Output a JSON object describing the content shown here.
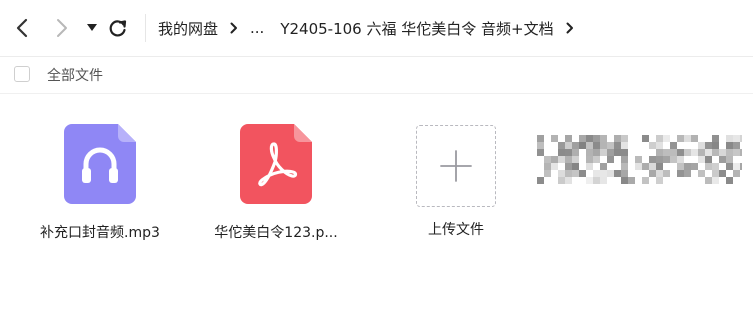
{
  "breadcrumb": {
    "root": "我的网盘",
    "ellipsis": "...",
    "current": "Y2405-106 六福 华佗美白令 音频+文档"
  },
  "subbar": {
    "select_all_label": "全部文件"
  },
  "files": [
    {
      "name": "补充口封音频.mp3",
      "type": "audio",
      "icon": "audio-file-icon",
      "color": "#8f87f5"
    },
    {
      "name": "华佗美白令123.p...",
      "type": "pdf",
      "icon": "pdf-file-icon",
      "color": "#f2545f"
    }
  ],
  "upload": {
    "label": "上传文件",
    "icon": "plus-icon"
  },
  "colors": {
    "chevron": "#222222",
    "divider": "#ececec",
    "upload_border": "#b9b9bf"
  }
}
